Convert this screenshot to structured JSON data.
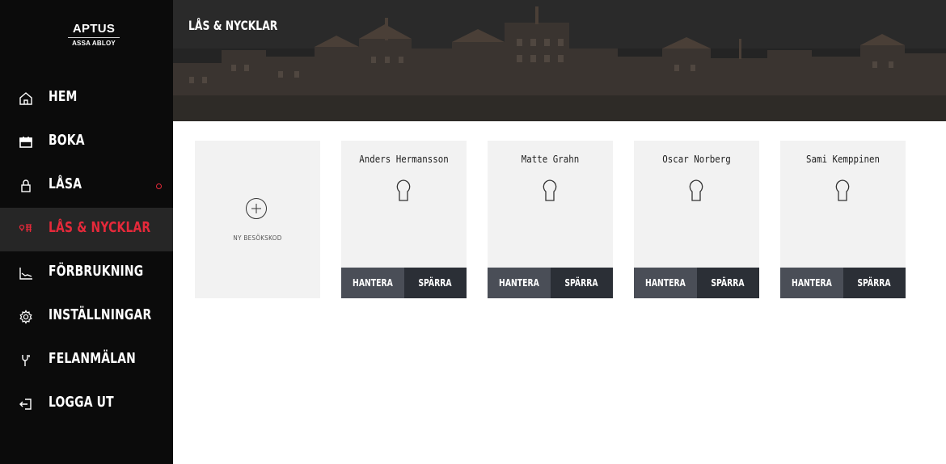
{
  "logo": {
    "name": "APTUS",
    "subtitle": "ASSA ABLOY"
  },
  "sidebar": {
    "items": [
      {
        "label": "HEM",
        "icon": "home-icon",
        "active": false
      },
      {
        "label": "BOKA",
        "icon": "calendar-icon",
        "active": false
      },
      {
        "label": "LÅSA",
        "icon": "lock-icon",
        "active": false,
        "indicator": true
      },
      {
        "label": "LÅS & NYCKLAR",
        "icon": "keys-icon",
        "active": true
      },
      {
        "label": "FÖRBRUKNING",
        "icon": "chart-icon",
        "active": false
      },
      {
        "label": "INSTÄLLNINGAR",
        "icon": "gear-icon",
        "active": false
      },
      {
        "label": "FELANMÄLAN",
        "icon": "wrench-icon",
        "active": false
      },
      {
        "label": "LOGGA UT",
        "icon": "logout-icon",
        "active": false
      }
    ]
  },
  "header": {
    "title": "LÅS & NYCKLAR"
  },
  "add_card": {
    "label": "NY BESÖKSKOD",
    "icon": "plus-circle-icon"
  },
  "keys": [
    {
      "name": "Anders Hermansson",
      "manage": "HANTERA",
      "block": "SPÄRRA"
    },
    {
      "name": "Matte Grahn",
      "manage": "HANTERA",
      "block": "SPÄRRA"
    },
    {
      "name": "Oscar Norberg",
      "manage": "HANTERA",
      "block": "SPÄRRA"
    },
    {
      "name": "Sami Kemppinen",
      "manage": "HANTERA",
      "block": "SPÄRRA"
    }
  ],
  "colors": {
    "accent": "#e5293a",
    "sidebar": "#0b0b0b",
    "active_bg": "#262626",
    "button_dark": "#2b2f36",
    "button_mid": "#4a4e57"
  }
}
